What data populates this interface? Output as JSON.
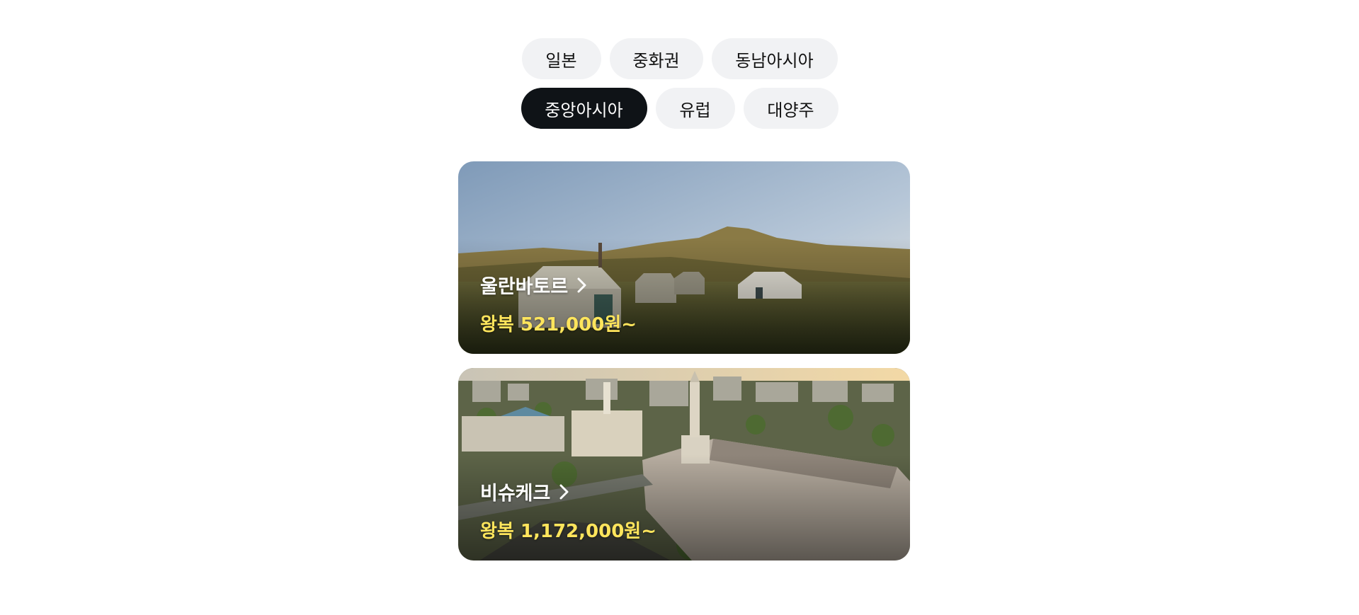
{
  "region_tabs": [
    {
      "label": "일본",
      "active": false
    },
    {
      "label": "중화권",
      "active": false
    },
    {
      "label": "동남아시아",
      "active": false
    },
    {
      "label": "중앙아시아",
      "active": true
    },
    {
      "label": "유럽",
      "active": false
    },
    {
      "label": "대양주",
      "active": false
    }
  ],
  "destinations": [
    {
      "city": "울란바토르",
      "price": "왕복 521,000원~",
      "image": "mongolian-steppe-gers"
    },
    {
      "city": "비슈케크",
      "price": "왕복 1,172,000원~",
      "image": "bishkek-aerial-city"
    }
  ],
  "colors": {
    "active_tab_bg": "#0f1317",
    "tab_bg": "#f1f2f4",
    "price_text": "#ffe55c"
  }
}
